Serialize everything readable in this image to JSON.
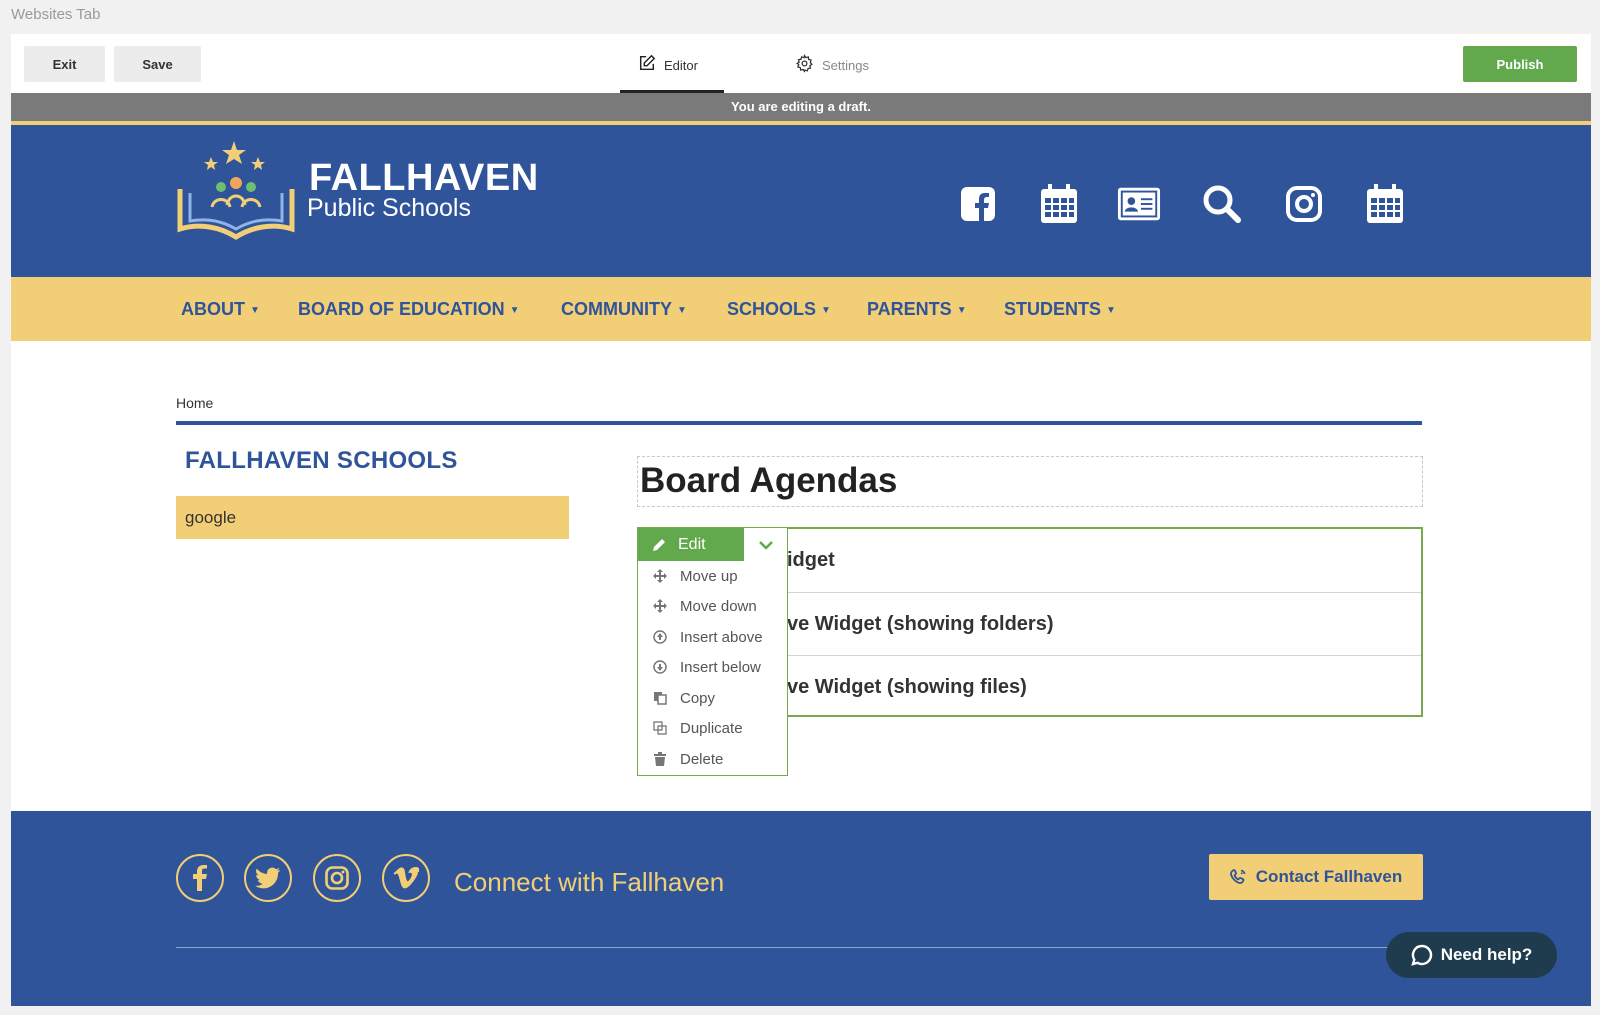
{
  "window": {
    "tab_title": "Websites Tab"
  },
  "toolbar": {
    "exit_label": "Exit",
    "save_label": "Save",
    "publish_label": "Publish",
    "tabs": [
      {
        "label": "Editor",
        "icon": "edit-icon",
        "active": true
      },
      {
        "label": "Settings",
        "icon": "gear-icon",
        "active": false
      }
    ]
  },
  "draft_notice": "You are editing a draft.",
  "site": {
    "logo_title": "FALLHAVEN",
    "logo_subtitle": "Public Schools",
    "header_icons": [
      "facebook-icon",
      "calendar-icon",
      "id-card-icon",
      "search-icon",
      "instagram-icon",
      "calendar-icon"
    ],
    "nav": [
      {
        "label": "ABOUT"
      },
      {
        "label": "BOARD OF EDUCATION"
      },
      {
        "label": "COMMUNITY"
      },
      {
        "label": "SCHOOLS"
      },
      {
        "label": "PARENTS"
      },
      {
        "label": "STUDENTS"
      }
    ]
  },
  "content": {
    "breadcrumb": "Home",
    "sidebar_title": "FALLHAVEN SCHOOLS",
    "sidebar_items": [
      {
        "label": "google"
      }
    ],
    "page_title": "Board Agendas",
    "widgets": [
      {
        "label": "idget"
      },
      {
        "label": "ve Widget (showing folders)"
      },
      {
        "label": "ve Widget (showing files)"
      }
    ]
  },
  "context_menu": {
    "edit_label": "Edit",
    "items": [
      {
        "label": "Move up",
        "icon": "move-icon"
      },
      {
        "label": "Move down",
        "icon": "move-icon"
      },
      {
        "label": "Insert above",
        "icon": "arrow-up-circle-icon"
      },
      {
        "label": "Insert below",
        "icon": "arrow-down-circle-icon"
      },
      {
        "label": "Copy",
        "icon": "copy-icon"
      },
      {
        "label": "Duplicate",
        "icon": "duplicate-icon"
      },
      {
        "label": "Delete",
        "icon": "trash-icon"
      }
    ]
  },
  "footer": {
    "connect_text": "Connect with Fallhaven",
    "contact_label": "Contact Fallhaven",
    "social": [
      "facebook-icon",
      "twitter-icon",
      "instagram-icon",
      "vimeo-icon"
    ]
  },
  "help_widget": {
    "label": "Need help?"
  },
  "colors": {
    "brand_blue": "#2f5499",
    "brand_yellow": "#f2cf76",
    "publish_green": "#62a84c",
    "help_dark": "#1f3c4e"
  }
}
